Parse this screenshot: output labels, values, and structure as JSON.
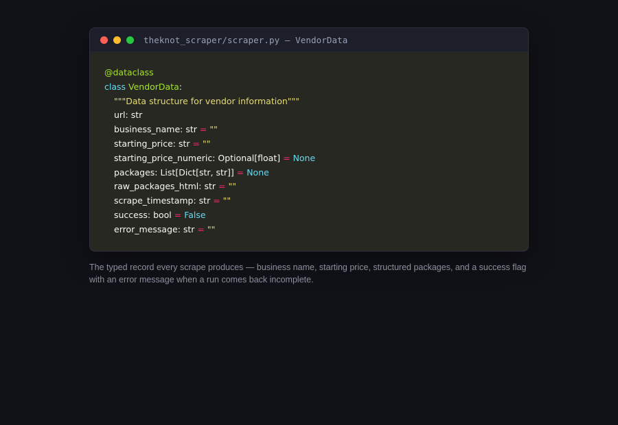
{
  "window": {
    "title": "theknot_scraper/scraper.py — VendorData",
    "traffic_lights": {
      "close_color": "#ff5f57",
      "minimize_color": "#febc2e",
      "maximize_color": "#28c840"
    }
  },
  "code": {
    "lines": [
      {
        "tokens": [
          {
            "t": "@dataclass",
            "c": "decorator"
          }
        ]
      },
      {
        "tokens": [
          {
            "t": "class ",
            "c": "keyword"
          },
          {
            "t": "VendorData",
            "c": "classname"
          },
          {
            "t": ":",
            "c": "plain"
          }
        ]
      },
      {
        "indent": 1,
        "tokens": [
          {
            "t": "\"\"\"Data structure for vendor information\"\"\"",
            "c": "string"
          }
        ]
      },
      {
        "indent": 1,
        "tokens": [
          {
            "t": "url: str",
            "c": "plain"
          }
        ]
      },
      {
        "indent": 1,
        "tokens": [
          {
            "t": "business_name: str ",
            "c": "plain"
          },
          {
            "t": "=",
            "c": "op"
          },
          {
            "t": " ",
            "c": "plain"
          },
          {
            "t": "\"\"",
            "c": "string"
          }
        ]
      },
      {
        "indent": 1,
        "tokens": [
          {
            "t": "starting_price: str ",
            "c": "plain"
          },
          {
            "t": "=",
            "c": "op"
          },
          {
            "t": " ",
            "c": "plain"
          },
          {
            "t": "\"\"",
            "c": "string"
          }
        ]
      },
      {
        "indent": 1,
        "tokens": [
          {
            "t": "starting_price_numeric: Optional[float] ",
            "c": "plain"
          },
          {
            "t": "=",
            "c": "op"
          },
          {
            "t": " ",
            "c": "plain"
          },
          {
            "t": "None",
            "c": "const"
          }
        ]
      },
      {
        "indent": 1,
        "tokens": [
          {
            "t": "packages: List[Dict[str, str]] ",
            "c": "plain"
          },
          {
            "t": "=",
            "c": "op"
          },
          {
            "t": " ",
            "c": "plain"
          },
          {
            "t": "None",
            "c": "const"
          }
        ]
      },
      {
        "indent": 1,
        "tokens": [
          {
            "t": "raw_packages_html: str ",
            "c": "plain"
          },
          {
            "t": "=",
            "c": "op"
          },
          {
            "t": " ",
            "c": "plain"
          },
          {
            "t": "\"\"",
            "c": "string"
          }
        ]
      },
      {
        "indent": 1,
        "tokens": [
          {
            "t": "scrape_timestamp: str ",
            "c": "plain"
          },
          {
            "t": "=",
            "c": "op"
          },
          {
            "t": " ",
            "c": "plain"
          },
          {
            "t": "\"\"",
            "c": "string"
          }
        ]
      },
      {
        "indent": 1,
        "tokens": [
          {
            "t": "success: bool ",
            "c": "plain"
          },
          {
            "t": "=",
            "c": "op"
          },
          {
            "t": " ",
            "c": "plain"
          },
          {
            "t": "False",
            "c": "const"
          }
        ]
      },
      {
        "indent": 1,
        "tokens": [
          {
            "t": "error_message: str ",
            "c": "plain"
          },
          {
            "t": "=",
            "c": "op"
          },
          {
            "t": " ",
            "c": "plain"
          },
          {
            "t": "\"\"",
            "c": "string"
          }
        ]
      }
    ]
  },
  "caption": "The typed record every scrape produces — business name, starting price, structured packages, and a success flag with an error message when a run comes back incomplete.",
  "colors": {
    "background": "#111218",
    "titlebar": "#1c1e2a",
    "editor": "#272822",
    "decorator": "#a6e22e",
    "keyword": "#66d9ef",
    "string": "#e6db74",
    "operator": "#f92672",
    "constant": "#66d9ef",
    "text": "#f8f8f2",
    "caption": "#8b8f9c"
  }
}
